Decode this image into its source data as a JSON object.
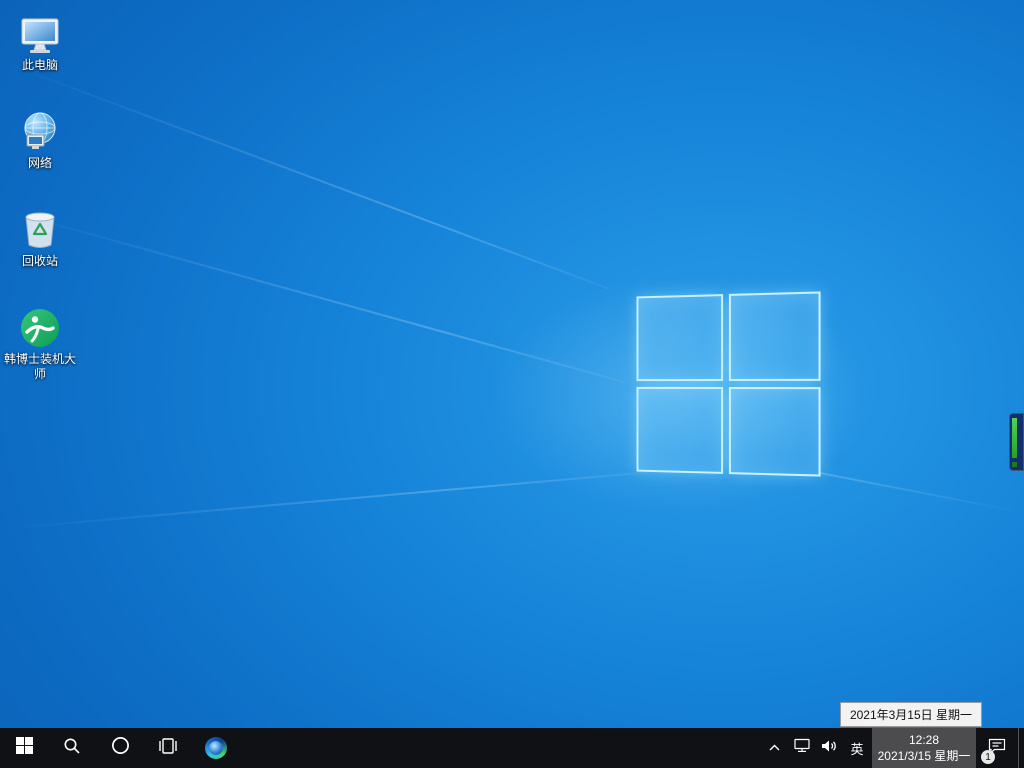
{
  "desktop": {
    "icons": [
      {
        "id": "this-pc",
        "label": "此电脑"
      },
      {
        "id": "network",
        "label": "网络"
      },
      {
        "id": "recycle-bin",
        "label": "回收站"
      },
      {
        "id": "hanboshi",
        "label": "韩博士装机大师"
      }
    ]
  },
  "tooltip": {
    "date_text": "2021年3月15日 星期一"
  },
  "taskbar": {
    "ime_label": "英",
    "clock": {
      "time": "12:28",
      "date": "2021/3/15 星期一"
    },
    "notification_badge": "1"
  },
  "colors": {
    "accent_blue": "#0d6cc4",
    "wallpaper_center": "#2b9de9",
    "wallpaper_edge": "#0a58ab",
    "taskbar_bg": "#101114",
    "clock_hover": "rgba(255,255,255,0.25)",
    "logo_pane_border": "#cdf5ff",
    "hanboshi_green": "#12a05f",
    "edge_widget_green": "#3ecf3e"
  }
}
